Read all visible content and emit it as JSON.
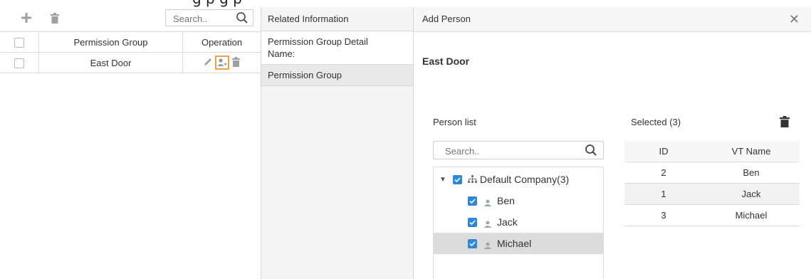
{
  "caption": "g                                                      p    g   p",
  "left_panel": {
    "search_placeholder": "Search..",
    "columns": [
      "Permission Group",
      "Operation"
    ],
    "rows": [
      {
        "name": "East Door"
      }
    ]
  },
  "middle_panel": {
    "title": "Related Information",
    "item1_line1": "Permission Group Detail",
    "item1_line2": "Name:",
    "item2": "Permission Group"
  },
  "right_panel": {
    "title": "Add Person",
    "group_name": "East Door",
    "person_list_label": "Person list",
    "search_placeholder": "Search..",
    "tree": {
      "root": "Default Company(3)",
      "children": [
        "Ben",
        "Jack",
        "Michael"
      ]
    },
    "selected_label": "Selected (3)",
    "selected_columns": [
      "ID",
      "VT Name"
    ],
    "selected_rows": [
      {
        "id": "2",
        "name": "Ben"
      },
      {
        "id": "1",
        "name": "Jack"
      },
      {
        "id": "3",
        "name": "Michael"
      }
    ]
  },
  "colors": {
    "accent_check": "#2d88d8",
    "highlight_border": "#f0a03c"
  }
}
